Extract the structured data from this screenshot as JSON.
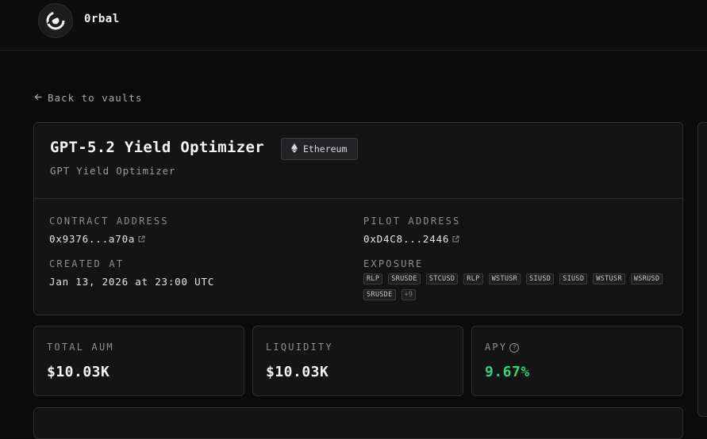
{
  "header": {
    "brand": "0rbal"
  },
  "nav": {
    "back_label": "Back to vaults"
  },
  "vault": {
    "title": "GPT-5.2 Yield Optimizer",
    "network": "Ethereum",
    "subtitle": "GPT Yield Optimizer",
    "contract_address_label": "CONTRACT ADDRESS",
    "contract_address": "0x9376...a70a",
    "pilot_address_label": "PILOT ADDRESS",
    "pilot_address": "0xD4C8...2446",
    "created_at_label": "CREATED AT",
    "created_at": "Jan 13, 2026 at 23:00 UTC",
    "exposure_label": "EXPOSURE",
    "exposure": [
      "RLP",
      "SRUSDE",
      "STCUSD",
      "RLP",
      "WSTUSR",
      "SIUSD",
      "SIUSD",
      "WSTUSR",
      "WSRUSD",
      "SRUSDE"
    ],
    "exposure_more": "+9"
  },
  "stats": {
    "total_aum_label": "TOTAL AUM",
    "total_aum": "$10.03K",
    "liquidity_label": "LIQUIDITY",
    "liquidity": "$10.03K",
    "apy_label": "APY",
    "apy": "9.67%",
    "apy_color": "#2fd37a"
  },
  "icons": {
    "logo": "orbit-logo-icon",
    "back": "arrow-left-icon",
    "network": "ethereum-icon",
    "external": "external-link-icon",
    "help": "help-circle-icon"
  }
}
